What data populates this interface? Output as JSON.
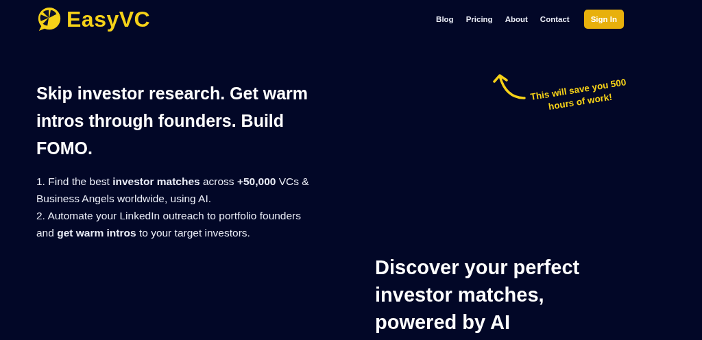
{
  "brand": {
    "name": "EasyVC"
  },
  "nav": {
    "links": [
      "Blog",
      "Pricing",
      "About",
      "Contact"
    ],
    "button": "Sign In"
  },
  "hero": {
    "headline": "Skip investor research. Get warm intros through founders. Build FOMO.",
    "points": [
      "1. Find the best **investor matches** across **+50,000** VCs & Business Angels worldwide, using AI.",
      "2. Automate your LinkedIn outreach to portfolio founders and **get warm intros** to your target investors."
    ],
    "callout": "This will save you 500 hours of work!"
  },
  "section": {
    "heading": "Discover your perfect investor matches, powered by AI"
  }
}
